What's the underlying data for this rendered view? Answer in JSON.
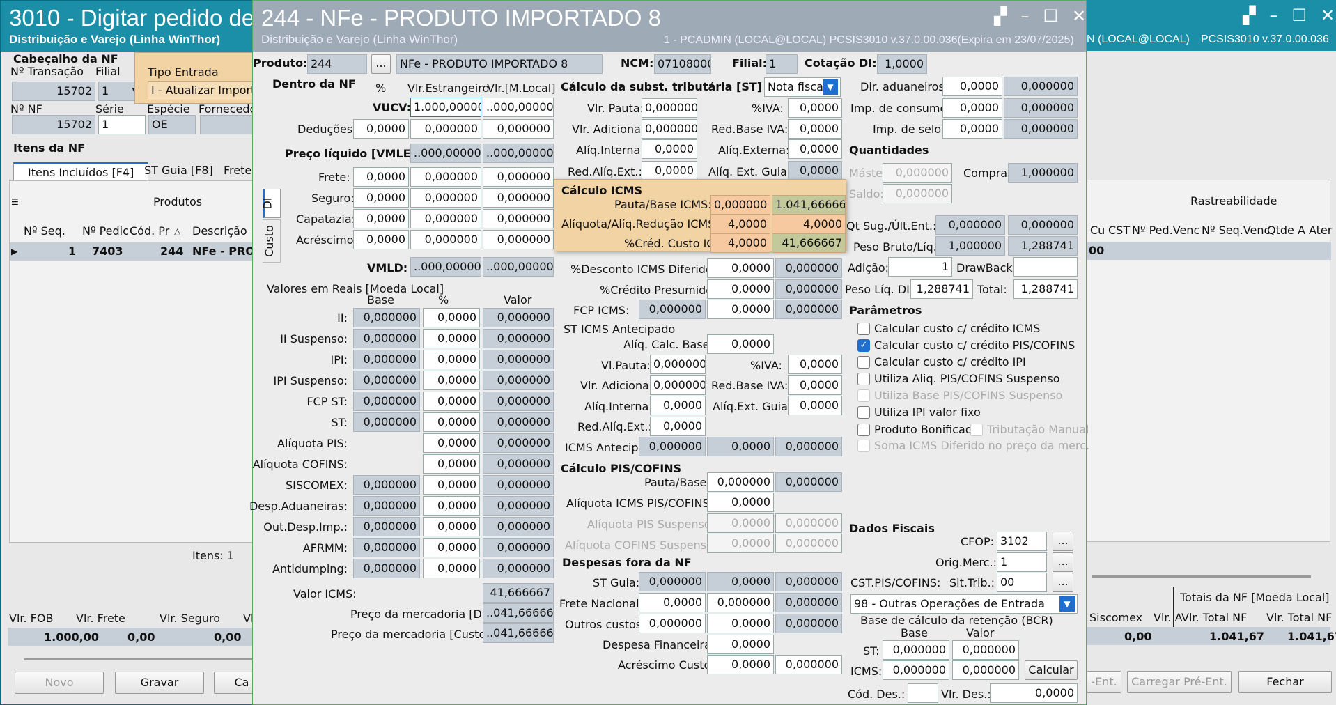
{
  "left": {
    "title": "3010 - Digitar pedido de",
    "subtitle": "Distribuição e Varejo (Linha WinThor)",
    "cab_title": "Cabeçalho da NF",
    "num_trans_label": "Nº Transação",
    "num_trans": "15702",
    "filial_label": "Filial",
    "filial": "1",
    "tipo_label": "Tipo Entrada",
    "tipo_value": "I - Atualizar Importa",
    "nnf_label": "Nº NF",
    "nnf": "15702",
    "serie_label": "Série",
    "serie": "1",
    "especie_label": "Espécie",
    "especie": "OE",
    "fornec_label": "Fornecedo",
    "itens_title": "Itens da NF",
    "tab1": "Itens Incluídos [F4]",
    "tab2": "ST Guia [F8]",
    "tab3": "Frete N",
    "grid_header": "Produtos",
    "col1": "Nº Seq.",
    "col2": "Nº Pedic",
    "col3": "Cód. Pr",
    "col4": "Descrição",
    "row": {
      "seq": "1",
      "ped": "7403",
      "cod": "244",
      "desc": "NFe - PROI"
    },
    "itens_count": "Itens: 1",
    "vfob_label": "Vlr. FOB",
    "vfob": "1.000,00",
    "vfrete_label": "Vlr. Frete",
    "vfrete": "0,00",
    "vseg_label": "Vlr. Seguro",
    "vseg": "0,00",
    "vl_cut": "Vl",
    "btn_novo": "Novo",
    "btn_gravar": "Gravar",
    "btn_ca": "Ca"
  },
  "right": {
    "title_tail": "N (LOCAL@LOCAL)",
    "version": "PCSIS3010 v.37.0.00.036",
    "rastreab": "Rastreabilidade",
    "cols": [
      "Cu",
      "CST",
      "Nº Ped.Venc",
      "Nº Seq.Venc",
      "Qtde A Ater"
    ],
    "row_val": "00",
    "totais_title": "Totais da NF [Moeda Local]",
    "siscomex_label": "Siscomex",
    "siscomex": "0,00",
    "vla_label": "Vlr. A",
    "vtnf1_label": "Vlr. Total NF",
    "vtnf1": "1.041,67",
    "vtnf2_label": "Vlr. Total NF",
    "vtnf2": "1.041,67",
    "btn_ent": "-Ent.",
    "btn_carregar": "Carregar Pré-Ent.",
    "btn_fechar": "Fechar"
  },
  "dlg": {
    "title": "244 - NFe - PRODUTO IMPORTADO 8",
    "subtitle": "Distribuição e Varejo (Linha WinThor)",
    "status": "1 - PCADMIN (LOCAL@LOCAL)   PCSIS3010  v.37.0.00.036(Expira em 23/07/2025)",
    "produto_label": "Produto:",
    "produto_cod": "244",
    "produto_desc": "NFe - PRODUTO IMPORTADO 8",
    "ncm_label": "NCM:",
    "ncm": "07108000",
    "filial_label": "Filial:",
    "filial": "1",
    "cot_label": "Cotação DI:",
    "cot": "1,0000",
    "tab_di": "DI",
    "tab_custo": "Custo",
    "dentro_nf": "Dentro da NF",
    "pct": "%",
    "vlr_estr": "Vlr.Estrangeiro",
    "vlr_ml": "Vlr.[M.Local]",
    "vucv_label": "VUCV:",
    "vucv_e": "1.000,000000",
    "vucv_m": "..000,000000",
    "ded_label": "Deduções:",
    "ded": [
      "0,0000",
      "0,000000",
      "0,000000"
    ],
    "pl_label": "Preço líquido [VMLE]",
    "pl_e": "..000,000000",
    "pl_m": "..000,000000",
    "frete_label": "Frete:",
    "frete": [
      "0,0000",
      "0,000000",
      "0,000000"
    ],
    "seguro_label": "Seguro:",
    "seguro": [
      "0,0000",
      "0,000000",
      "0,000000"
    ],
    "capat_label": "Capatazia:",
    "capat": [
      "0,0000",
      "0,000000",
      "0,000000"
    ],
    "acres_label": "Acréscimo:",
    "acres": [
      "0,0000",
      "0,000000",
      "0,000000"
    ],
    "vmld_label": "VMLD:",
    "vmld_e": "..000,000000",
    "vmld_m": "..000,000000",
    "vr_title": "Valores em Reais [Moeda Local]",
    "vr_base": "Base",
    "vr_pct": "%",
    "vr_valor": "Valor",
    "vr_rows": [
      {
        "label": "II:",
        "base": "0,000000",
        "pct": "0,0000",
        "val": "0,000000"
      },
      {
        "label": "II Suspenso:",
        "base": "0,000000",
        "pct": "0,0000",
        "val": "0,000000"
      },
      {
        "label": "IPI:",
        "base": "0,000000",
        "pct": "0,0000",
        "val": "0,000000"
      },
      {
        "label": "IPI Suspenso:",
        "base": "0,000000",
        "pct": "0,0000",
        "val": "0,000000"
      },
      {
        "label": "FCP ST:",
        "base": "0,000000",
        "pct": "0,0000",
        "val": "0,000000"
      },
      {
        "label": "ST:",
        "base": "0,000000",
        "pct": "0,0000",
        "val": "0,000000"
      },
      {
        "label": "Alíquota PIS:",
        "base": "",
        "pct": "0,0000",
        "val": "0,000000"
      },
      {
        "label": "Alíquota COFINS:",
        "base": "",
        "pct": "0,0000",
        "val": "0,000000"
      },
      {
        "label": "SISCOMEX:",
        "base": "0,000000",
        "pct": "0,0000",
        "val": "0,000000"
      },
      {
        "label": "Desp.Aduaneiras:",
        "base": "0,000000",
        "pct": "0,0000",
        "val": "0,000000"
      },
      {
        "label": "Out.Desp.Imp.:",
        "base": "0,000000",
        "pct": "0,0000",
        "val": "0,000000"
      },
      {
        "label": "AFRMM:",
        "base": "0,000000",
        "pct": "0,0000",
        "val": "0,000000"
      },
      {
        "label": "Antidumping:",
        "base": "0,000000",
        "pct": "0,0000",
        "val": "0,000000"
      }
    ],
    "valor_icms_label": "Valor ICMS:",
    "valor_icms": "41,666667",
    "pm_di_label": "Preço da mercadoria [DI]:",
    "pm_di": "..041,666667",
    "pm_custo_label": "Preço da mercadoria [Custo]:",
    "pm_custo": "..041,666667",
    "st_title": "Cálculo da subst. tributária [ST]",
    "st_sel": "Nota fiscal",
    "vpauta_label": "Vlr. Pauta:",
    "vpauta": "0,000000",
    "iva_label": "%IVA:",
    "iva": "0,0000",
    "vadic_label": "Vlr. Adicional:",
    "vadic": "0,000000",
    "rbiva_label": "Red.Base IVA:",
    "rbiva": "0,0000",
    "aint_label": "Alíq.Interna:",
    "aint": "0,0000",
    "aext_label": "Alíq.Externa:",
    "aext": "0,0000",
    "raext_label": "Red.Alíq.Ext.:",
    "raext": "0,0000",
    "aeg_label": "Alíq. Ext. Guia:",
    "aeg": "0,0000",
    "icms_title": "Cálculo ICMS",
    "pbi_label": "Pauta/Base ICMS:",
    "pbi1": "0,000000",
    "pbi2": "1.041,666667",
    "aar_label": "Alíquota/Alíq.Redução ICMS:",
    "aar1": "4,0000",
    "aar2": "4,0000",
    "pcc_label": "%Créd. Custo ICMS:",
    "pcc1": "4,0000",
    "pcc2": "41,666667",
    "pdid_label": "%Desconto ICMS Diferido:",
    "pdid1": "0,0000",
    "pdid2": "0,000000",
    "pcp_label": "%Crédito Presumido:",
    "pcp1": "0,0000",
    "pcp2": "0,000000",
    "fcp_label": "FCP ICMS:",
    "fcp1": "0,000000",
    "fcp2": "0,0000",
    "fcp3": "0,000000",
    "stant_title": "ST ICMS Antecipado",
    "acb_label": "Alíq. Calc. Base:",
    "acb": "0,0000",
    "vlp_label": "Vl.Pauta:",
    "vlp": "0,000000",
    "iva2_label": "%IVA:",
    "iva2": "0,0000",
    "vad2_label": "Vlr. Adicional:",
    "vad2": "0,000000",
    "rbi2_label": "Red.Base IVA:",
    "rbi2": "0,0000",
    "ai2_label": "Alíq.Interna:",
    "ai2": "0,0000",
    "aeg2_label": "Alíq.Ext. Guia:",
    "aeg2": "0,0000",
    "rae2_label": "Red.Alíq.Ext.:",
    "rae2": "0,0000",
    "ia_label": "ICMS Antecip:",
    "ia1": "0,000000",
    "ia2": "0,0000",
    "ia3": "0,000000",
    "pc_title": "Cálculo PIS/COFINS",
    "ppb_label": "Pauta/Base:",
    "ppb1": "0,000000",
    "ppb2": "0,000000",
    "aipc_label": "Alíquota ICMS PIS/COFINS:",
    "aipc": "0,0000",
    "aps_label": "Alíquota PIS Suspenso:",
    "aps1": "0,0000",
    "aps2": "0,000000",
    "acs_label": "Alíquota COFINS Suspenso:",
    "acs1": "0,0000",
    "acs2": "0,000000",
    "dfn_title": "Despesas fora da NF",
    "stg_label": "ST Guia:",
    "stg": [
      "0,000000",
      "0,0000",
      "0,000000"
    ],
    "fn_label": "Frete Nacional:",
    "fn": [
      "0,0000",
      "0,000000",
      "0,000000"
    ],
    "oc_label": "Outros custos:",
    "oc": [
      "0,000000",
      "0,0000",
      "0,000000"
    ],
    "df_label": "Despesa Financeira:",
    "df": "0,0000",
    "ac_label": "Acréscimo Custo:",
    "ac1": "0,0000",
    "ac2": "0,000000",
    "dira_label": "Dir. aduaneiros:",
    "dira1": "0,0000",
    "dira2": "0,000000",
    "impc_label": "Imp. de consumo:",
    "impc1": "0,0000",
    "impc2": "0,000000",
    "imps_label": "Imp. de selo:",
    "imps1": "0,0000",
    "imps2": "0,000000",
    "qtd_title": "Quantidades",
    "master_label": "Máster:",
    "master": "0,000000",
    "compra_label": "Compra:",
    "compra": "1,000000",
    "saldo_label": "Saldo:",
    "saldo": "0,000000",
    "qsug_label": "Qt Sug./Últ.Ent.:",
    "qsug1": "0,000000",
    "qsug2": "0,000000",
    "peso_label": "Peso Bruto/Líq.:",
    "peso1": "1,000000",
    "peso2": "1,288741",
    "adicao_label": "Adição:",
    "adicao": "1",
    "draw_label": "DrawBack:",
    "draw": "",
    "pldi_label": "Peso Líq. DI:",
    "pldi": "1,288741",
    "total_label": "Total:",
    "total": "1,288741",
    "param_title": "Parâmetros",
    "params": [
      {
        "label": "Calcular custo c/ crédito ICMS",
        "checked": false,
        "enabled": true
      },
      {
        "label": "Calcular custo c/ crédito PIS/COFINS",
        "checked": true,
        "enabled": true
      },
      {
        "label": "Calcular custo c/ crédito IPI",
        "checked": false,
        "enabled": true
      },
      {
        "label": "Utiliza Aliq. PIS/COFINS Suspenso",
        "checked": false,
        "enabled": true
      },
      {
        "label": "Utiliza Base PIS/COFINS Suspenso",
        "checked": false,
        "enabled": false
      },
      {
        "label": "Utiliza IPI valor fixo",
        "checked": false,
        "enabled": true
      }
    ],
    "prod_bonif": "Produto Bonificado",
    "trib_manual": "Tributação Manual",
    "soma_icms": "Soma ICMS Diferido no preço da merc.",
    "df_title": "Dados Fiscais",
    "cfop_label": "CFOP:",
    "cfop": "3102",
    "orig_label": "Orig.Merc.:",
    "orig": "1",
    "cst_label": "CST.PIS/COFINS:",
    "sit_label": "Sit.Trib.:",
    "sit": "00",
    "oper": "98 - Outras Operações de Entrada",
    "bcr_title": "Base de cálculo da retenção (BCR)",
    "bcr_base": "Base",
    "bcr_valor": "Valor",
    "bst_label": "ST:",
    "bst1": "0,000000",
    "bst2": "0,000000",
    "bicms_label": "ICMS:",
    "bicms1": "0,000000",
    "bicms2": "0,000000",
    "calc_btn": "Calcular",
    "cdes_label": "Cód. Des.:",
    "cdes": "",
    "vdes_label": "Vlr. Des.:",
    "vdes": "0,0000",
    "dots": "..."
  }
}
